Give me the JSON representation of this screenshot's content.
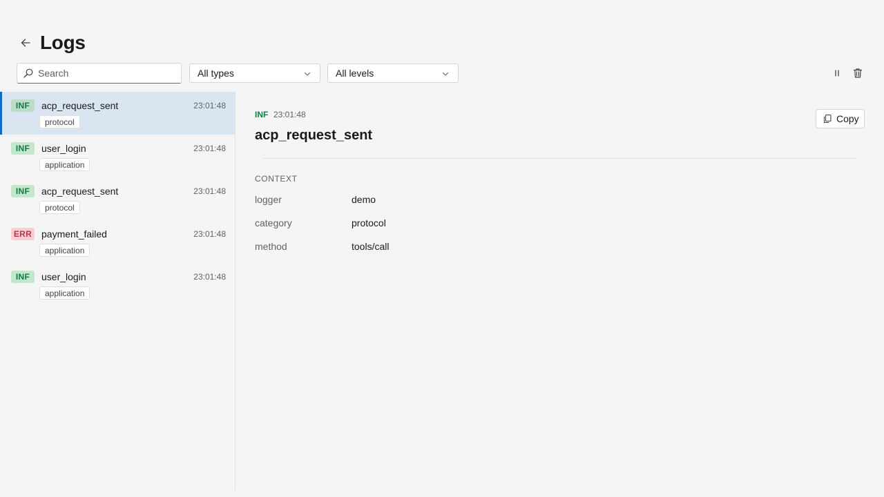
{
  "header": {
    "title": "Logs"
  },
  "toolbar": {
    "search_placeholder": "Search",
    "type_filter": "All types",
    "level_filter": "All levels"
  },
  "logs": [
    {
      "level": "INF",
      "name": "acp_request_sent",
      "time": "23:01:48",
      "tag": "protocol",
      "selected": true
    },
    {
      "level": "INF",
      "name": "user_login",
      "time": "23:01:48",
      "tag": "application"
    },
    {
      "level": "INF",
      "name": "acp_request_sent",
      "time": "23:01:48",
      "tag": "protocol"
    },
    {
      "level": "ERR",
      "name": "payment_failed",
      "time": "23:01:48",
      "tag": "application"
    },
    {
      "level": "INF",
      "name": "user_login",
      "time": "23:01:48",
      "tag": "application"
    }
  ],
  "detail": {
    "level": "INF",
    "time": "23:01:48",
    "title": "acp_request_sent",
    "copy_label": "Copy",
    "context_heading": "CONTEXT",
    "context": [
      {
        "key": "logger",
        "value": "demo"
      },
      {
        "key": "category",
        "value": "protocol"
      },
      {
        "key": "method",
        "value": "tools/call"
      }
    ]
  },
  "colors": {
    "accent": "#0f6cbd",
    "info": "#107c41",
    "error": "#c4314b",
    "selected_row": "#d9e6f1"
  }
}
